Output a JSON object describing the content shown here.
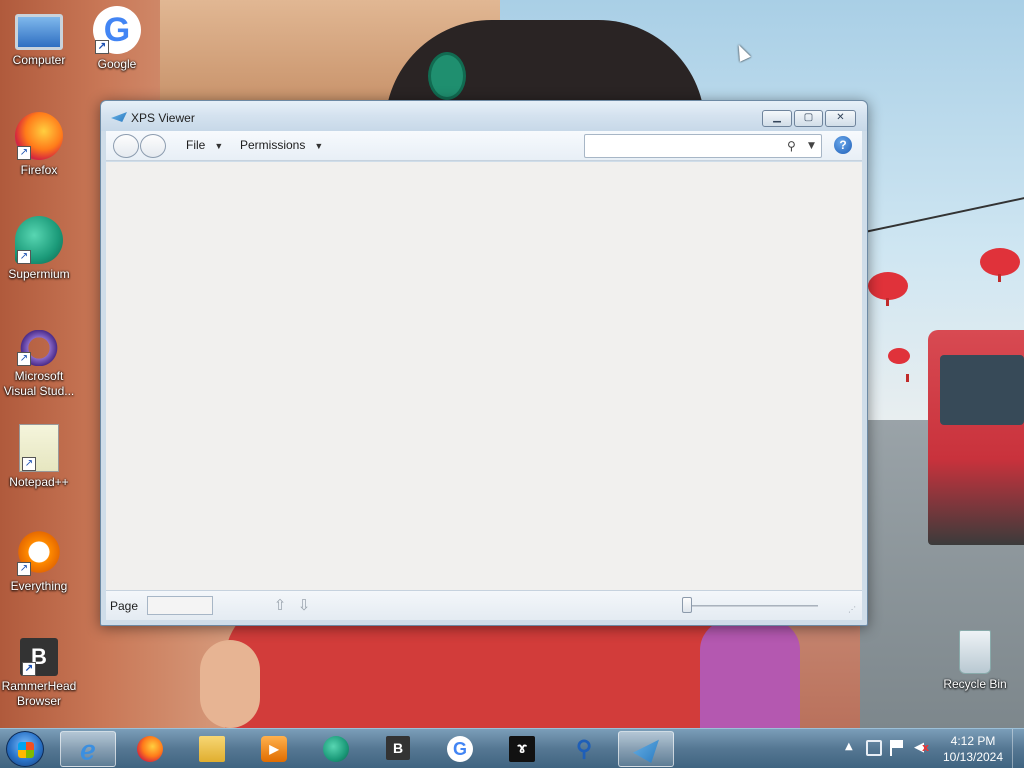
{
  "desktop": {
    "icons": [
      {
        "label": "Computer"
      },
      {
        "label": "Google"
      },
      {
        "label": "Firefox"
      },
      {
        "label": "Supermium"
      },
      {
        "label": "Microsoft Visual Stud..."
      },
      {
        "label": "Notepad++"
      },
      {
        "label": "Everything"
      },
      {
        "label": "RammerHead Browser"
      },
      {
        "label": "Recycle Bin"
      }
    ],
    "google_glyph": "G",
    "rammer_glyph": "B"
  },
  "window": {
    "title": "XPS Viewer",
    "menus": {
      "file": "File",
      "permissions": "Permissions"
    },
    "search": {
      "value": "",
      "placeholder": ""
    },
    "help_glyph": "?",
    "status": {
      "page_label": "Page",
      "page_value": ""
    }
  },
  "taskbar": {
    "rammer_glyph": "B",
    "google_glyph": "G",
    "clock": {
      "time": "4:12 PM",
      "date": "10/13/2024"
    }
  },
  "colors": {
    "window_frame": "#cfdde9",
    "content_bg": "#f1f0ee",
    "taskbar": "#50788f",
    "accent": "#2a7bc2"
  }
}
